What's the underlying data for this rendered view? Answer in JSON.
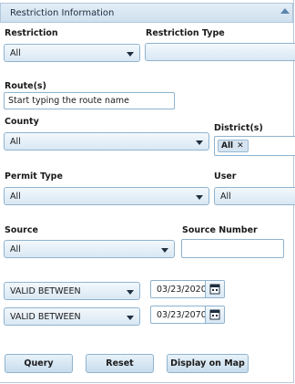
{
  "header": {
    "title": "Restriction Information"
  },
  "restriction": {
    "label": "Restriction",
    "value": "All"
  },
  "restriction_type": {
    "label": "Restriction Type",
    "value": ""
  },
  "routes": {
    "label": "Route(s)",
    "placeholder": "Start typing the route name"
  },
  "county": {
    "label": "County",
    "value": "All"
  },
  "districts": {
    "label": "District(s)",
    "tag": "All",
    "tag_remove": "✕"
  },
  "permit_type": {
    "label": "Permit Type",
    "value": "All"
  },
  "user": {
    "label": "User",
    "value": "All"
  },
  "source": {
    "label": "Source",
    "value": "All"
  },
  "source_number": {
    "label": "Source Number",
    "value": ""
  },
  "date_filters": [
    {
      "mode": "VALID BETWEEN",
      "date": "03/23/2020"
    },
    {
      "mode": "VALID BETWEEN",
      "date": "03/23/2070"
    }
  ],
  "buttons": {
    "query": "Query",
    "reset": "Reset",
    "display_on_map": "Display on Map"
  },
  "colors": {
    "field_border": "#8fb3cf",
    "header_bg": "#d6e6f3",
    "button_bg": "#c6dced"
  }
}
